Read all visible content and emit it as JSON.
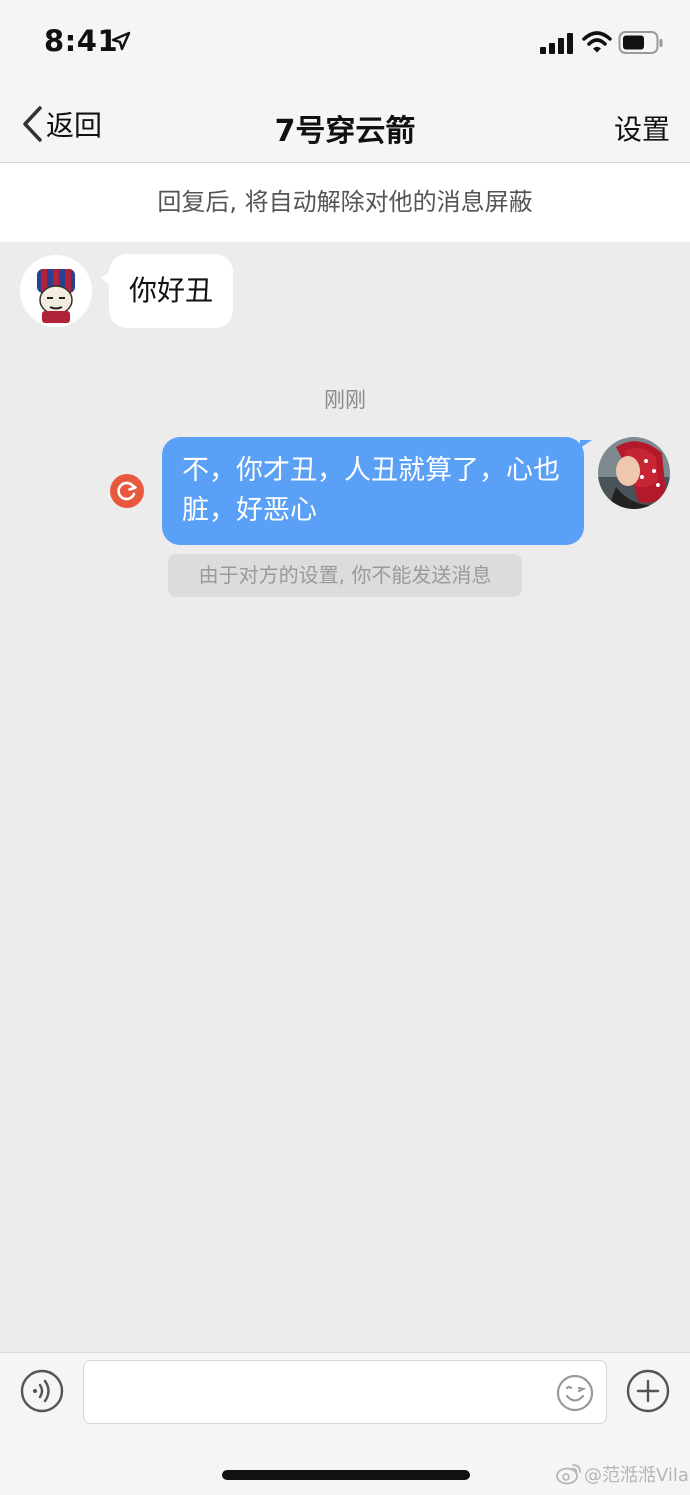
{
  "status_bar": {
    "time": "8:41",
    "icons": [
      "location-arrow-icon",
      "cellular-signal-icon",
      "wifi-icon",
      "battery-icon"
    ]
  },
  "nav": {
    "back_label": "返回",
    "title": "7号穿云箭",
    "settings_label": "设置"
  },
  "notice": "回复后, 将自动解除对他的消息屏蔽",
  "messages": [
    {
      "direction": "incoming",
      "text": "你好丑"
    },
    {
      "direction": "timestamp",
      "text": "刚刚"
    },
    {
      "direction": "outgoing",
      "text": "不，你才丑，人丑就算了，心也脏，好恶心",
      "status": "failed"
    },
    {
      "direction": "system",
      "text": "由于对方的设置, 你不能发送消息"
    }
  ],
  "input_bar": {
    "placeholder": "",
    "icons": [
      "voice-icon",
      "emoji-icon",
      "add-icon"
    ]
  },
  "watermark": "@范湉湉Vila",
  "colors": {
    "outgoing_bubble": "#5aa0f7",
    "retry_badge": "#e8583d",
    "background": "#ececec"
  }
}
